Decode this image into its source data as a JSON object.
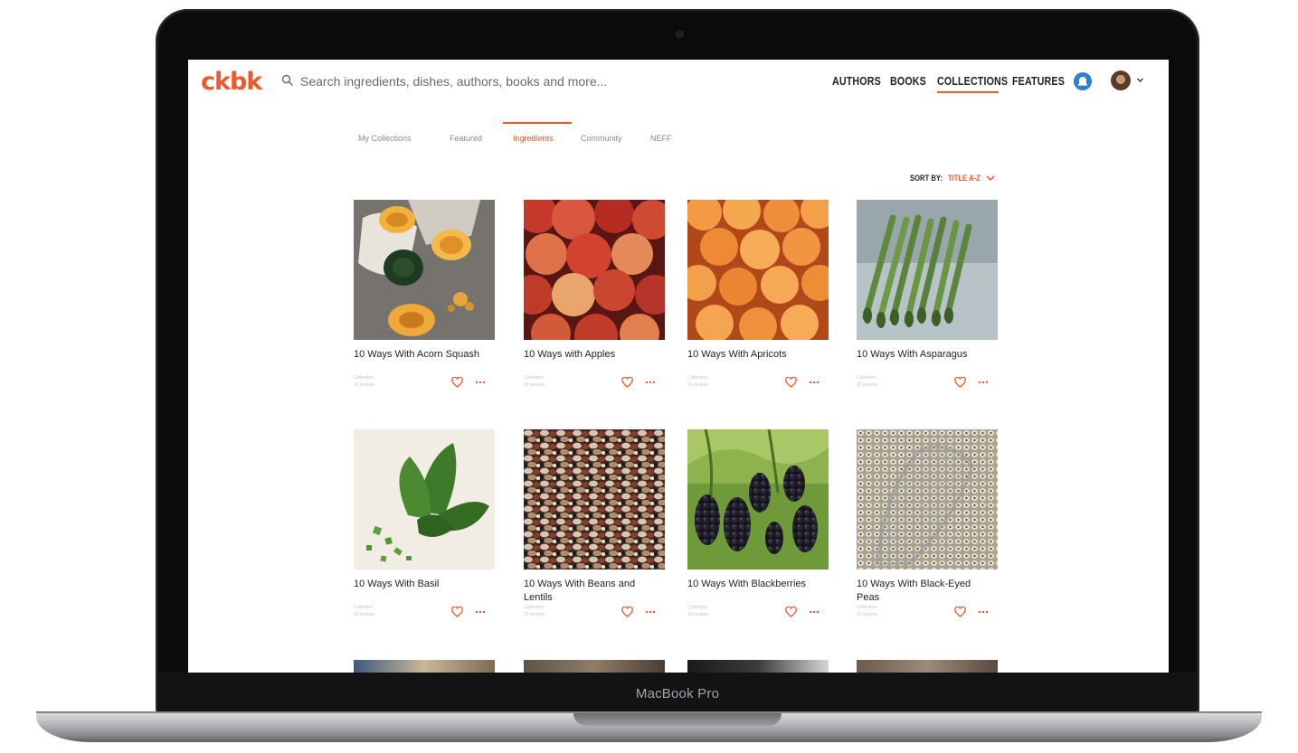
{
  "device": {
    "label": "MacBook Pro"
  },
  "header": {
    "logo": "ckbk",
    "search_placeholder": "Search ingredients, dishes, authors, books and more...",
    "nav": [
      "AUTHORS",
      "BOOKS",
      "COLLECTIONS",
      "FEATURES"
    ],
    "active_nav": "COLLECTIONS"
  },
  "tabs": [
    "My Collections",
    "Featured",
    "Ingredients",
    "Community",
    "NEFF"
  ],
  "active_tab": "Ingredients",
  "sort": {
    "label": "SORT BY:",
    "value": "TITLE A-Z"
  },
  "cards": [
    {
      "title": "10 Ways With Acorn Squash",
      "meta1": "Collection",
      "meta2": "10 recipes"
    },
    {
      "title": "10 Ways with Apples",
      "meta1": "Collection",
      "meta2": "10 recipes"
    },
    {
      "title": "10 Ways With Apricots",
      "meta1": "Collection",
      "meta2": "10 recipes"
    },
    {
      "title": "10 Ways With Asparagus",
      "meta1": "Collection",
      "meta2": "10 recipes"
    },
    {
      "title": "10 Ways With Basil",
      "meta1": "Collection",
      "meta2": "10 recipes"
    },
    {
      "title": "10 Ways With Beans and Lentils",
      "meta1": "Collection",
      "meta2": "20 recipes"
    },
    {
      "title": "10 Ways With Blackberries",
      "meta1": "Collection",
      "meta2": "10 recipes"
    },
    {
      "title": "10 Ways With Black-Eyed Peas",
      "meta1": "Collection",
      "meta2": "10 recipes"
    }
  ],
  "colors": {
    "accent": "#f0582a",
    "text": "#222222"
  }
}
